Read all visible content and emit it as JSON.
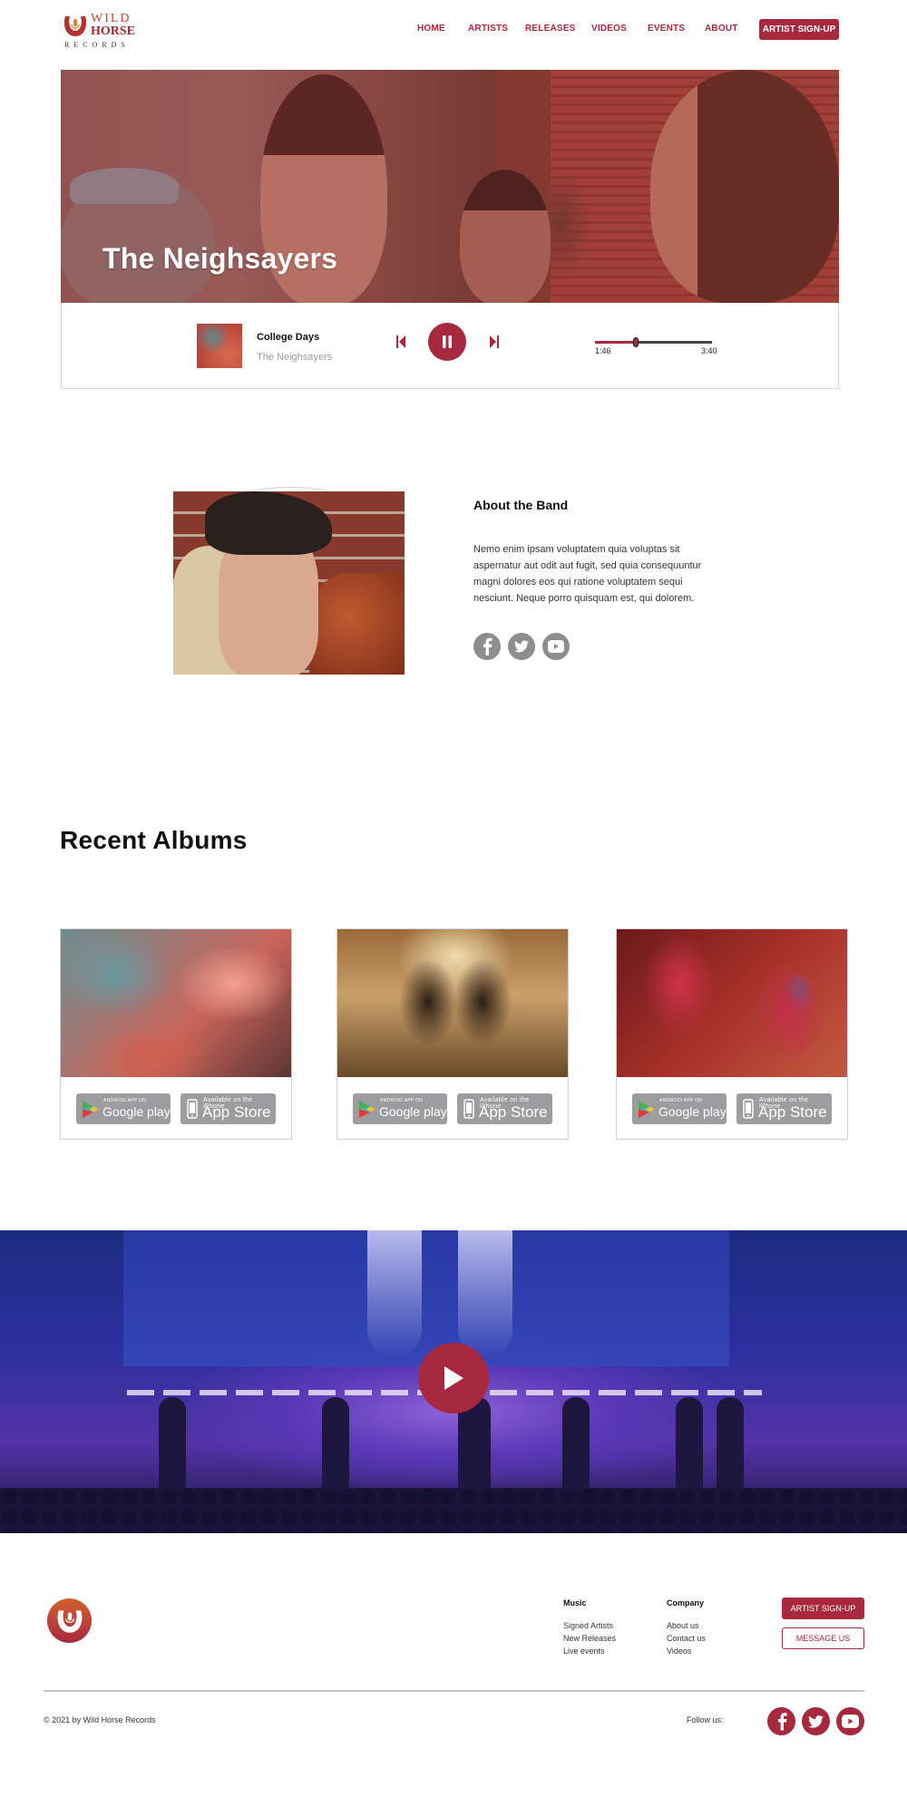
{
  "brand": {
    "line1": "WILD",
    "line2": "HORSE",
    "line3": "RECORDS",
    "accent": "#a8283d"
  },
  "nav": {
    "items": [
      "HOME",
      "ARTISTS",
      "RELEASES",
      "VIDEOS",
      "EVENTS",
      "ABOUT"
    ],
    "cta": "ARTIST SIGN-UP"
  },
  "hero": {
    "title": "The Neighsayers"
  },
  "player": {
    "song_title": "College Days",
    "song_artist": "The Neighsayers",
    "current_time": "1:46",
    "total_time": "3:40",
    "progress_fraction": 0.35,
    "state": "playing"
  },
  "about": {
    "title": "About the Band",
    "text": "Nemo enim ipsam voluptatem quia voluptas sit aspernatur aut odit aut fugit, sed quia consequuntur magni dolores eos qui ratione voluptatem sequi nesciunt. Neque porro quisquam est, qui dolorem.",
    "social": [
      "facebook-icon",
      "twitter-icon",
      "youtube-icon"
    ]
  },
  "albums": {
    "title": "Recent Albums",
    "badges": {
      "google_small": "ANDROID APP ON",
      "google_big": "Google play",
      "apple_small": "Available on the iPhone",
      "apple_big": "App Store"
    },
    "items": [
      {
        "art": "pink-clouds"
      },
      {
        "art": "blurred-crowd"
      },
      {
        "art": "red-hands"
      }
    ]
  },
  "video": {
    "play_icon": "play-icon"
  },
  "footer": {
    "music_heading": "Music",
    "music_links": [
      "Signed Artists",
      "New Releases",
      "Live events"
    ],
    "company_heading": "Company",
    "company_links": [
      "About us",
      "Contact us",
      "Videos"
    ],
    "signup_label": "ARTIST SIGN-UP",
    "message_label": "MESSAGE US",
    "copyright": "© 2021 by Wild Horse Records",
    "follow_label": "Follow us:"
  }
}
